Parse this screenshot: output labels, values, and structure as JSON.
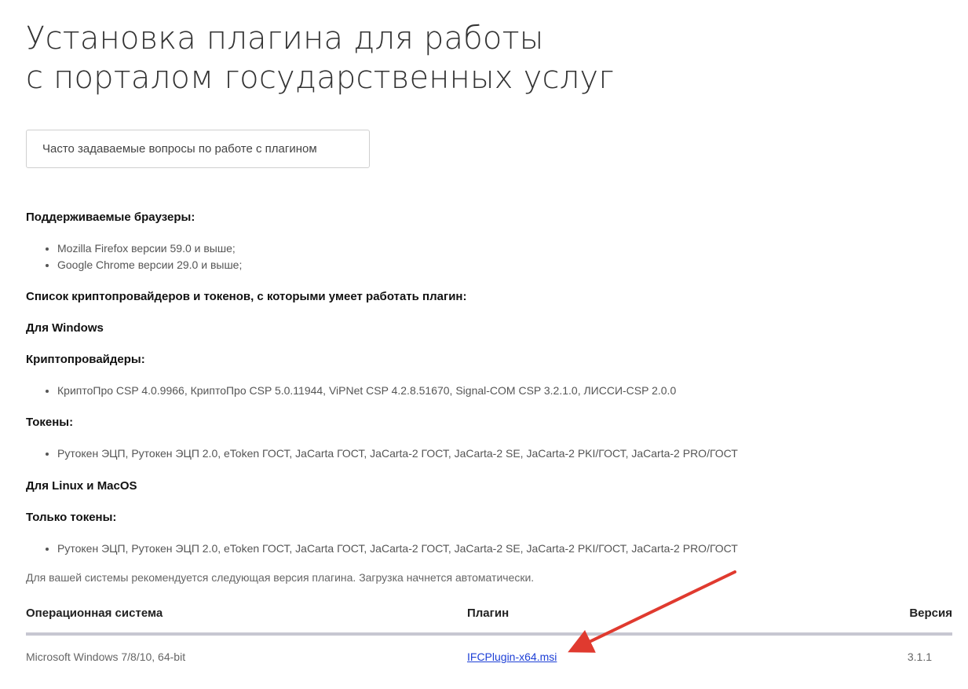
{
  "page": {
    "title_line1": "Установка плагина для работы",
    "title_line2": "с порталом государственных услуг",
    "faq_button": "Часто задаваемые вопросы по работе с плагином"
  },
  "sections": {
    "browsers_heading": "Поддерживаемые браузеры:",
    "browsers": [
      "Mozilla Firefox версии 59.0 и выше;",
      "Google Chrome версии 29.0 и выше;"
    ],
    "crypto_list_heading": "Список криптопровайдеров и токенов, с которыми умеет работать плагин:",
    "windows_heading": "Для Windows",
    "cryptoproviders_heading": "Криптопровайдеры:",
    "cryptoproviders": [
      "КриптоПро CSP 4.0.9966, КриптоПро CSP 5.0.11944, ViPNet CSP 4.2.8.51670, Signal-COM CSP 3.2.1.0, ЛИССИ-CSP 2.0.0"
    ],
    "tokens_heading": "Токены:",
    "tokens_windows": [
      "Рутокен ЭЦП, Рутокен ЭЦП 2.0, eToken ГОСТ, JaCarta ГОСТ, JaCarta-2 ГОСТ, JaCarta-2 SE, JaCarta-2 PKI/ГОСТ, JaCarta-2 PRO/ГОСТ"
    ],
    "linux_mac_heading": "Для Linux и MacOS",
    "only_tokens_heading": "Только токены:",
    "tokens_linux": [
      "Рутокен ЭЦП, Рутокен ЭЦП 2.0, eToken ГОСТ, JaCarta ГОСТ, JaCarta-2 ГОСТ, JaCarta-2 SE, JaCarta-2 PKI/ГОСТ, JaCarta-2 PRO/ГОСТ"
    ],
    "recommendation": "Для вашей системы рекомендуется следующая версия плагина. Загрузка начнется автоматически."
  },
  "table": {
    "headers": {
      "os": "Операционная система",
      "plugin": "Плагин",
      "version": "Версия"
    },
    "row": {
      "os": "Microsoft Windows 7/8/10, 64-bit",
      "plugin": "IFCPlugin-x64.msi",
      "version": "3.1.1"
    }
  },
  "colors": {
    "link": "#1d3fd6",
    "arrow": "#e03a2f",
    "divider": "#c7c7d1"
  }
}
